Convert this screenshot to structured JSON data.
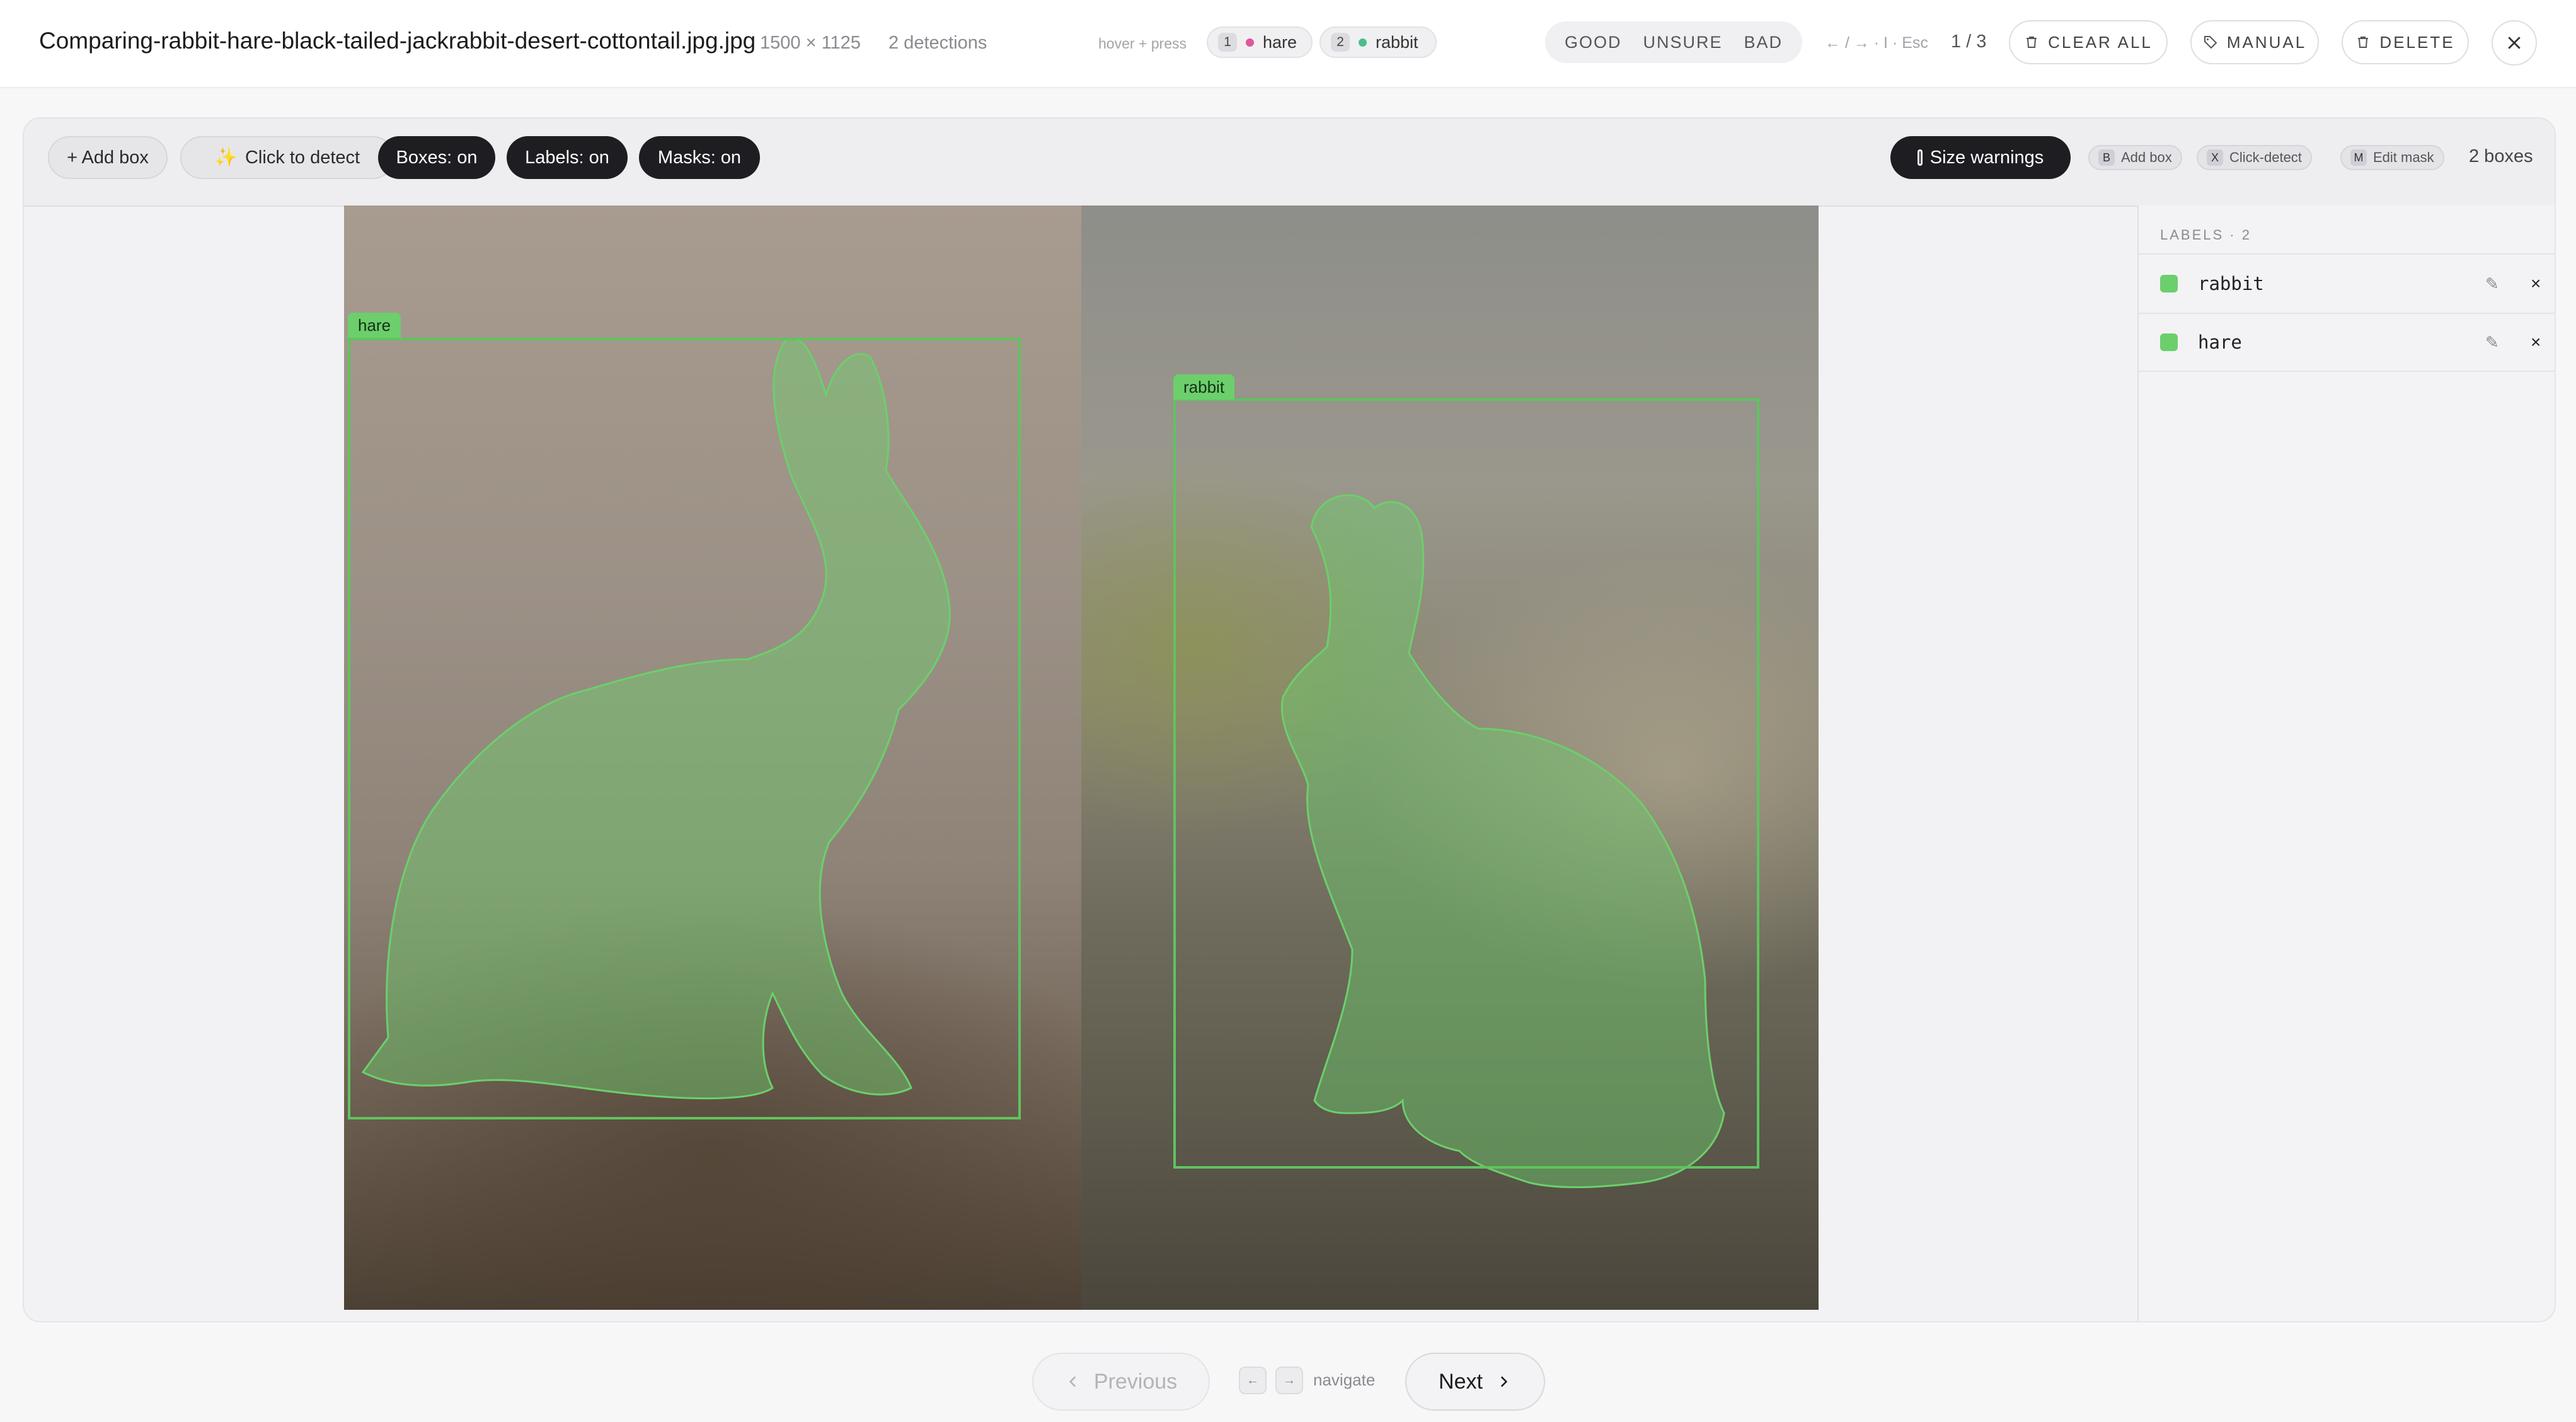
{
  "header": {
    "filename": "Comparing-rabbit-hare-black-tailed-jackrabbit-desert-cottontail.jpg.jpg",
    "dimensions": "1500 × 1125",
    "detections": "2 detections",
    "hover_hint": "hover + press",
    "label_chips": [
      {
        "key": "1",
        "label": "hare",
        "dot_color": "#e0569a"
      },
      {
        "key": "2",
        "label": "rabbit",
        "dot_color": "#4bbf8a"
      }
    ],
    "rating": {
      "good": "GOOD",
      "unsure": "UNSURE",
      "bad": "BAD"
    },
    "nav_hint": "← / → · I · Esc",
    "pager": "1 / 3",
    "clear_all": "CLEAR ALL",
    "manual": "MANUAL",
    "delete": "DELETE"
  },
  "toolbar": {
    "add_box": "+ Add box",
    "click_to_detect": "Click to detect",
    "boxes": "Boxes: on",
    "labels": "Labels: on",
    "masks": "Masks: on",
    "size_warnings": "Size warnings",
    "shortcuts": [
      {
        "key": "B",
        "label": "Add box"
      },
      {
        "key": "X",
        "label": "Click-detect"
      },
      {
        "key": "M",
        "label": "Edit mask"
      }
    ],
    "box_count": "2 boxes"
  },
  "annotations": [
    {
      "label": "hare"
    },
    {
      "label": "rabbit"
    }
  ],
  "sidebar": {
    "title": "LABELS · 2",
    "items": [
      {
        "name": "rabbit",
        "color": "#6ccf6c",
        "edit_icon": "✎",
        "remove_icon": "×"
      },
      {
        "name": "hare",
        "color": "#6ccf6c",
        "edit_icon": "✎",
        "remove_icon": "×"
      }
    ]
  },
  "footer": {
    "previous": "Previous",
    "navigate": "navigate",
    "next": "Next",
    "prev_key": "←",
    "next_key": "→"
  },
  "colors": {
    "mask": "#6ccf6c",
    "box": "#5fc45f",
    "dark_button": "#1e1e22"
  }
}
